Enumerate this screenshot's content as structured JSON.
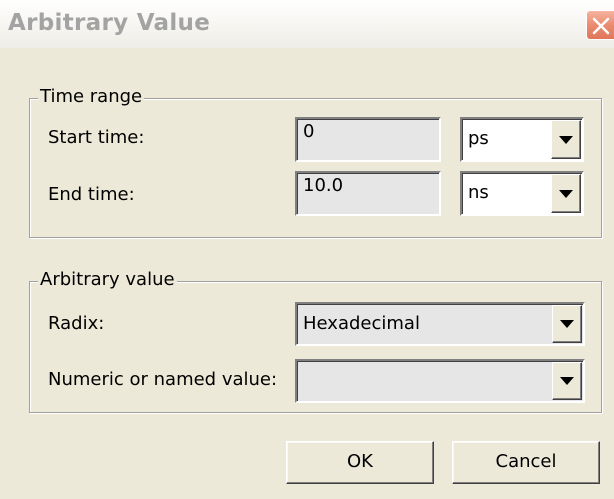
{
  "window": {
    "title": "Arbitrary Value"
  },
  "time_range": {
    "legend": "Time range",
    "start_label": "Start time:",
    "start_value": "0",
    "start_unit": "ps",
    "end_label": "End time:",
    "end_value": "10.0",
    "end_unit": "ns"
  },
  "arbitrary_value": {
    "legend": "Arbitrary value",
    "radix_label": "Radix:",
    "radix_value": "Hexadecimal",
    "value_label": "Numeric or named value:",
    "value_value": ""
  },
  "buttons": {
    "ok": "OK",
    "cancel": "Cancel"
  },
  "icons": {
    "close": "close-icon",
    "dropdown": "chevron-down-icon"
  },
  "colors": {
    "dialog_bg": "#ece9d8",
    "title_text": "#a3a3a3",
    "close_button": "#e0765a"
  }
}
